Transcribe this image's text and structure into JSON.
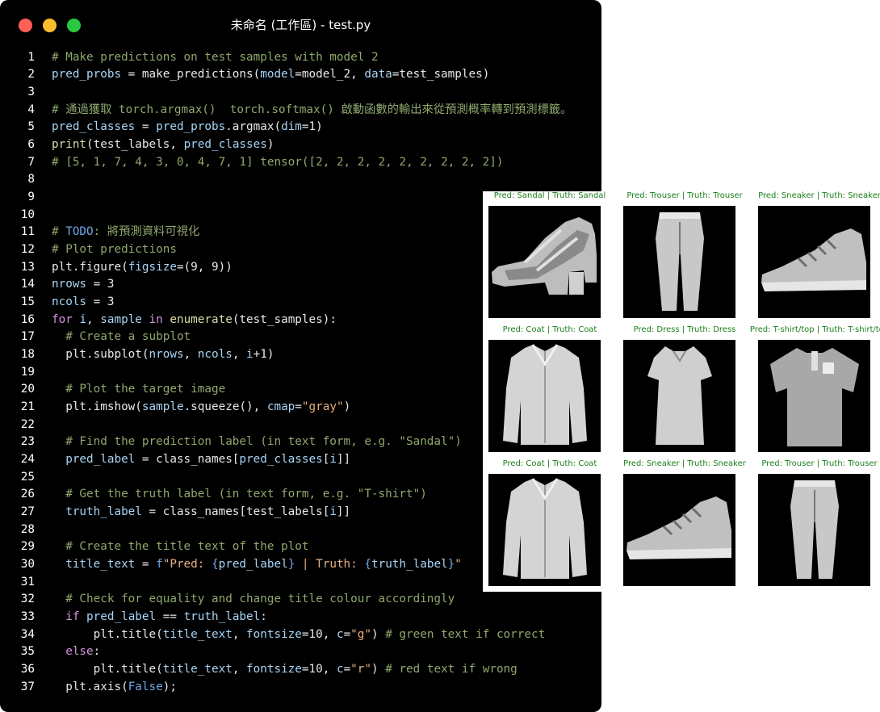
{
  "window": {
    "title": "未命名 (工作區) - test.py"
  },
  "code_lines": [
    {
      "n": "1",
      "t": [
        {
          "c": "comment",
          "s": "# Make predictions on test samples with model 2"
        }
      ]
    },
    {
      "n": "2",
      "t": [
        {
          "c": "ident",
          "s": "pred_probs"
        },
        {
          "c": "plain",
          "s": " = "
        },
        {
          "c": "plain",
          "s": "make_predictions("
        },
        {
          "c": "ident",
          "s": "model"
        },
        {
          "c": "plain",
          "s": "=model_2, "
        },
        {
          "c": "ident",
          "s": "data"
        },
        {
          "c": "plain",
          "s": "=test_samples)"
        }
      ]
    },
    {
      "n": "3",
      "t": []
    },
    {
      "n": "4",
      "t": [
        {
          "c": "comment",
          "s": "# 通過獲取 torch.argmax()  torch.softmax() 啟動函數的輸出來從預測概率轉到預測標籤。"
        }
      ]
    },
    {
      "n": "5",
      "t": [
        {
          "c": "ident",
          "s": "pred_classes"
        },
        {
          "c": "plain",
          "s": " = "
        },
        {
          "c": "ident",
          "s": "pred_probs"
        },
        {
          "c": "plain",
          "s": ".argmax("
        },
        {
          "c": "ident",
          "s": "dim"
        },
        {
          "c": "plain",
          "s": "=1)"
        }
      ]
    },
    {
      "n": "6",
      "t": [
        {
          "c": "builtin",
          "s": "print"
        },
        {
          "c": "plain",
          "s": "(test_labels, "
        },
        {
          "c": "ident",
          "s": "pred_classes"
        },
        {
          "c": "plain",
          "s": ")"
        }
      ]
    },
    {
      "n": "7",
      "t": [
        {
          "c": "comment",
          "s": "# [5, 1, 7, 4, 3, 0, 4, 7, 1] tensor([2, 2, 2, 2, 2, 2, 2, 2, 2])"
        }
      ]
    },
    {
      "n": "8",
      "t": []
    },
    {
      "n": "9",
      "t": []
    },
    {
      "n": "10",
      "t": []
    },
    {
      "n": "11",
      "t": [
        {
          "c": "comment",
          "s": "# "
        },
        {
          "c": "todo",
          "s": "TODO"
        },
        {
          "c": "comment",
          "s": ": 將預測資料可視化"
        }
      ]
    },
    {
      "n": "12",
      "t": [
        {
          "c": "comment",
          "s": "# Plot predictions"
        }
      ]
    },
    {
      "n": "13",
      "t": [
        {
          "c": "plain",
          "s": "plt.figure("
        },
        {
          "c": "ident",
          "s": "figsize"
        },
        {
          "c": "plain",
          "s": "=(9, 9))"
        }
      ]
    },
    {
      "n": "14",
      "t": [
        {
          "c": "ident",
          "s": "nrows"
        },
        {
          "c": "plain",
          "s": " = 3"
        }
      ]
    },
    {
      "n": "15",
      "t": [
        {
          "c": "ident",
          "s": "ncols"
        },
        {
          "c": "plain",
          "s": " = 3"
        }
      ]
    },
    {
      "n": "16",
      "t": [
        {
          "c": "kw",
          "s": "for"
        },
        {
          "c": "plain",
          "s": " "
        },
        {
          "c": "ident",
          "s": "i"
        },
        {
          "c": "plain",
          "s": ", "
        },
        {
          "c": "ident",
          "s": "sample"
        },
        {
          "c": "plain",
          "s": " "
        },
        {
          "c": "kw",
          "s": "in"
        },
        {
          "c": "plain",
          "s": " "
        },
        {
          "c": "builtin",
          "s": "enumerate"
        },
        {
          "c": "plain",
          "s": "(test_samples):"
        }
      ]
    },
    {
      "n": "17",
      "t": [
        {
          "c": "plain",
          "s": "  "
        },
        {
          "c": "comment",
          "s": "# Create a subplot"
        }
      ]
    },
    {
      "n": "18",
      "t": [
        {
          "c": "plain",
          "s": "  plt.subplot("
        },
        {
          "c": "ident",
          "s": "nrows"
        },
        {
          "c": "plain",
          "s": ", "
        },
        {
          "c": "ident",
          "s": "ncols"
        },
        {
          "c": "plain",
          "s": ", "
        },
        {
          "c": "ident",
          "s": "i"
        },
        {
          "c": "plain",
          "s": "+1)"
        }
      ]
    },
    {
      "n": "19",
      "t": []
    },
    {
      "n": "20",
      "t": [
        {
          "c": "plain",
          "s": "  "
        },
        {
          "c": "comment",
          "s": "# Plot the target image"
        }
      ]
    },
    {
      "n": "21",
      "t": [
        {
          "c": "plain",
          "s": "  plt.imshow("
        },
        {
          "c": "ident",
          "s": "sample"
        },
        {
          "c": "plain",
          "s": ".squeeze(), "
        },
        {
          "c": "ident",
          "s": "cmap"
        },
        {
          "c": "plain",
          "s": "="
        },
        {
          "c": "str",
          "s": "\"gray\""
        },
        {
          "c": "plain",
          "s": ")"
        }
      ]
    },
    {
      "n": "22",
      "t": []
    },
    {
      "n": "23",
      "t": [
        {
          "c": "plain",
          "s": "  "
        },
        {
          "c": "comment",
          "s": "# Find the prediction label (in text form, e.g. \"Sandal\")"
        }
      ]
    },
    {
      "n": "24",
      "t": [
        {
          "c": "plain",
          "s": "  "
        },
        {
          "c": "ident",
          "s": "pred_label"
        },
        {
          "c": "plain",
          "s": " = class_names["
        },
        {
          "c": "ident",
          "s": "pred_classes"
        },
        {
          "c": "plain",
          "s": "["
        },
        {
          "c": "ident",
          "s": "i"
        },
        {
          "c": "plain",
          "s": "]]"
        }
      ]
    },
    {
      "n": "25",
      "t": []
    },
    {
      "n": "26",
      "t": [
        {
          "c": "plain",
          "s": "  "
        },
        {
          "c": "comment",
          "s": "# Get the truth label (in text form, e.g. \"T-shirt\")"
        }
      ]
    },
    {
      "n": "27",
      "t": [
        {
          "c": "plain",
          "s": "  "
        },
        {
          "c": "ident",
          "s": "truth_label"
        },
        {
          "c": "plain",
          "s": " = class_names[test_labels["
        },
        {
          "c": "ident",
          "s": "i"
        },
        {
          "c": "plain",
          "s": "]]"
        }
      ]
    },
    {
      "n": "28",
      "t": []
    },
    {
      "n": "29",
      "t": [
        {
          "c": "plain",
          "s": "  "
        },
        {
          "c": "comment",
          "s": "# Create the title text of the plot"
        }
      ]
    },
    {
      "n": "30",
      "t": [
        {
          "c": "plain",
          "s": "  "
        },
        {
          "c": "ident",
          "s": "title_text"
        },
        {
          "c": "plain",
          "s": " = "
        },
        {
          "c": "blue",
          "s": "f"
        },
        {
          "c": "str",
          "s": "\"Pred: "
        },
        {
          "c": "blue",
          "s": "{"
        },
        {
          "c": "ident",
          "s": "pred_label"
        },
        {
          "c": "blue",
          "s": "}"
        },
        {
          "c": "str",
          "s": " | Truth: "
        },
        {
          "c": "blue",
          "s": "{"
        },
        {
          "c": "ident",
          "s": "truth_label"
        },
        {
          "c": "blue",
          "s": "}"
        },
        {
          "c": "str",
          "s": "\""
        }
      ]
    },
    {
      "n": "31",
      "t": []
    },
    {
      "n": "32",
      "t": [
        {
          "c": "plain",
          "s": "  "
        },
        {
          "c": "comment",
          "s": "# Check for equality and change title colour accordingly"
        }
      ]
    },
    {
      "n": "33",
      "t": [
        {
          "c": "plain",
          "s": "  "
        },
        {
          "c": "kw",
          "s": "if"
        },
        {
          "c": "plain",
          "s": " "
        },
        {
          "c": "ident",
          "s": "pred_label"
        },
        {
          "c": "plain",
          "s": " == "
        },
        {
          "c": "ident",
          "s": "truth_label"
        },
        {
          "c": "plain",
          "s": ":"
        }
      ]
    },
    {
      "n": "34",
      "t": [
        {
          "c": "plain",
          "s": "      plt.title("
        },
        {
          "c": "ident",
          "s": "title_text"
        },
        {
          "c": "plain",
          "s": ", "
        },
        {
          "c": "ident",
          "s": "fontsize"
        },
        {
          "c": "plain",
          "s": "=10, "
        },
        {
          "c": "ident",
          "s": "c"
        },
        {
          "c": "plain",
          "s": "="
        },
        {
          "c": "str",
          "s": "\"g\""
        },
        {
          "c": "plain",
          "s": ") "
        },
        {
          "c": "comment",
          "s": "# green text if correct"
        }
      ]
    },
    {
      "n": "35",
      "t": [
        {
          "c": "plain",
          "s": "  "
        },
        {
          "c": "kw",
          "s": "else"
        },
        {
          "c": "plain",
          "s": ":"
        }
      ]
    },
    {
      "n": "36",
      "t": [
        {
          "c": "plain",
          "s": "      plt.title("
        },
        {
          "c": "ident",
          "s": "title_text"
        },
        {
          "c": "plain",
          "s": ", "
        },
        {
          "c": "ident",
          "s": "fontsize"
        },
        {
          "c": "plain",
          "s": "=10, "
        },
        {
          "c": "ident",
          "s": "c"
        },
        {
          "c": "plain",
          "s": "="
        },
        {
          "c": "str",
          "s": "\"r\""
        },
        {
          "c": "plain",
          "s": ") "
        },
        {
          "c": "comment",
          "s": "# red text if wrong"
        }
      ]
    },
    {
      "n": "37",
      "t": [
        {
          "c": "plain",
          "s": "  plt.axis("
        },
        {
          "c": "blue",
          "s": "False"
        },
        {
          "c": "plain",
          "s": ");"
        }
      ]
    }
  ],
  "plot_grid": {
    "title_color": "#1a7f1a",
    "panels": [
      {
        "title": "Pred: Sandal | Truth: Sandal",
        "item": "sandal-image"
      },
      {
        "title": "Pred: Trouser | Truth: Trouser",
        "item": "trouser-image"
      },
      {
        "title": "Pred: Sneaker | Truth: Sneaker",
        "item": "sneaker-image"
      },
      {
        "title": "Pred: Coat | Truth: Coat",
        "item": "coat-image"
      },
      {
        "title": "Pred: Dress | Truth: Dress",
        "item": "dress-image"
      },
      {
        "title": "Pred: T-shirt/top | Truth: T-shirt/top",
        "item": "tshirt-image"
      },
      {
        "title": "Pred: Coat | Truth: Coat",
        "item": "coat-image"
      },
      {
        "title": "Pred: Sneaker | Truth: Sneaker",
        "item": "sneaker-image"
      },
      {
        "title": "Pred: Trouser | Truth: Trouser",
        "item": "trouser-image"
      }
    ]
  },
  "colors": {
    "background": "#000000",
    "comment": "#8fa86d",
    "identifier": "#a8d4f5",
    "keyword": "#d493dd",
    "string": "#e6b07f",
    "traffic_red": "#ff5f57",
    "traffic_yellow": "#febc2e",
    "traffic_green": "#28c840"
  }
}
